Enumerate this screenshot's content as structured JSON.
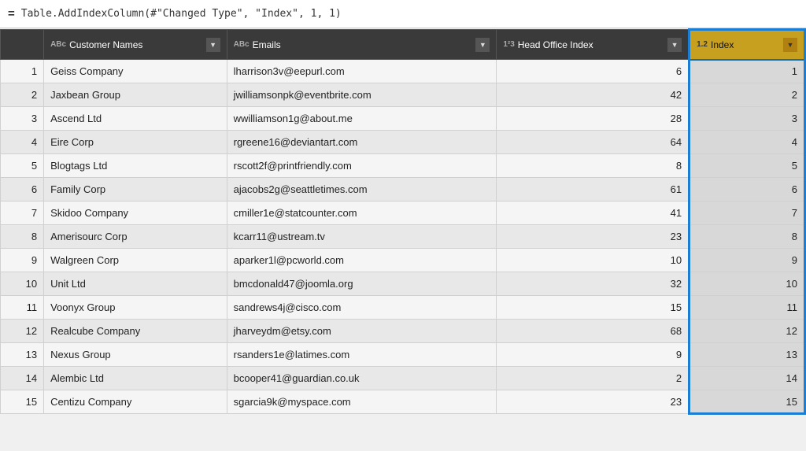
{
  "formula_bar": {
    "equals": "=",
    "formula": "Table.AddIndexColumn(#\"Changed Type\", \"Index\", 1, 1)"
  },
  "columns": [
    {
      "id": "row-num",
      "icon": "",
      "label": "",
      "type": "row"
    },
    {
      "id": "customer-names",
      "icon": "ABc",
      "label": "Customer Names",
      "type": "text"
    },
    {
      "id": "emails",
      "icon": "ABc",
      "label": "Emails",
      "type": "text"
    },
    {
      "id": "head-office-index",
      "icon": "1²3",
      "label": "Head Office Index",
      "type": "num"
    },
    {
      "id": "index",
      "icon": "1.2",
      "label": "Index",
      "type": "num",
      "highlighted": true
    }
  ],
  "rows": [
    {
      "num": 1,
      "customer": "Geiss Company",
      "email": "lharrison3v@eepurl.com",
      "head_office": 6,
      "index": 1
    },
    {
      "num": 2,
      "customer": "Jaxbean Group",
      "email": "jwilliamsonpk@eventbrite.com",
      "head_office": 42,
      "index": 2
    },
    {
      "num": 3,
      "customer": "Ascend Ltd",
      "email": "wwilliamson1g@about.me",
      "head_office": 28,
      "index": 3
    },
    {
      "num": 4,
      "customer": "Eire Corp",
      "email": "rgreene16@deviantart.com",
      "head_office": 64,
      "index": 4
    },
    {
      "num": 5,
      "customer": "Blogtags Ltd",
      "email": "rscott2f@printfriendly.com",
      "head_office": 8,
      "index": 5
    },
    {
      "num": 6,
      "customer": "Family Corp",
      "email": "ajacobs2g@seattletimes.com",
      "head_office": 61,
      "index": 6
    },
    {
      "num": 7,
      "customer": "Skidoo Company",
      "email": "cmiller1e@statcounter.com",
      "head_office": 41,
      "index": 7
    },
    {
      "num": 8,
      "customer": "Amerisourc Corp",
      "email": "kcarr11@ustream.tv",
      "head_office": 23,
      "index": 8
    },
    {
      "num": 9,
      "customer": "Walgreen Corp",
      "email": "aparker1l@pcworld.com",
      "head_office": 10,
      "index": 9
    },
    {
      "num": 10,
      "customer": "Unit Ltd",
      "email": "bmcdonald47@joomla.org",
      "head_office": 32,
      "index": 10
    },
    {
      "num": 11,
      "customer": "Voonyx Group",
      "email": "sandrews4j@cisco.com",
      "head_office": 15,
      "index": 11
    },
    {
      "num": 12,
      "customer": "Realcube Company",
      "email": "jharveydm@etsy.com",
      "head_office": 68,
      "index": 12
    },
    {
      "num": 13,
      "customer": "Nexus Group",
      "email": "rsanders1e@latimes.com",
      "head_office": 9,
      "index": 13
    },
    {
      "num": 14,
      "customer": "Alembic Ltd",
      "email": "bcooper41@guardian.co.uk",
      "head_office": 2,
      "index": 14
    },
    {
      "num": 15,
      "customer": "Centizu Company",
      "email": "sgarcia9k@myspace.com",
      "head_office": 23,
      "index": 15
    }
  ]
}
